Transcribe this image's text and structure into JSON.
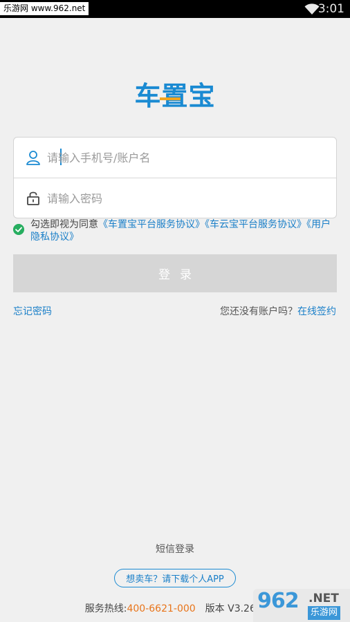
{
  "status_bar": {
    "watermark_text": "乐游网 www.962.net",
    "time": "3:01",
    "wifi_icon": "wifi-icon"
  },
  "logo": {
    "text": "车置宝",
    "color": "#1a8ad2",
    "accent_color": "#f1a521"
  },
  "login_form": {
    "username": {
      "placeholder": "请输入手机号/账户名",
      "value": "",
      "icon": "user-icon"
    },
    "password": {
      "placeholder": "请输入密码",
      "value": "",
      "icon": "lock-icon"
    }
  },
  "agreement": {
    "checked": true,
    "prefix": "勾选即视为同意",
    "link_platform": "《车置宝平台服务协议》",
    "link_cloud": "《车云宝平台服务协议》",
    "link_privacy": "《用户隐私协议》"
  },
  "login_button": {
    "label": "登录",
    "enabled": false
  },
  "links": {
    "forgot_password": "忘记密码",
    "no_account_prompt": "您还没有账户吗？",
    "sign_online": "在线签约"
  },
  "sms_login": "短信登录",
  "sell_car_button": "想卖车？请下载个人APP",
  "footer": {
    "hotline_label": "服务热线:",
    "hotline_number": "400-6621-000",
    "version": "版本 V3.26.0"
  },
  "watermark": {
    "brand": "962",
    "suffix": ".NET",
    "site_name": "乐游网"
  },
  "colors": {
    "link": "#1a7fc8",
    "hotline": "#e8741a",
    "button_disabled": "#d6d6d6",
    "check": "#27ae60"
  }
}
